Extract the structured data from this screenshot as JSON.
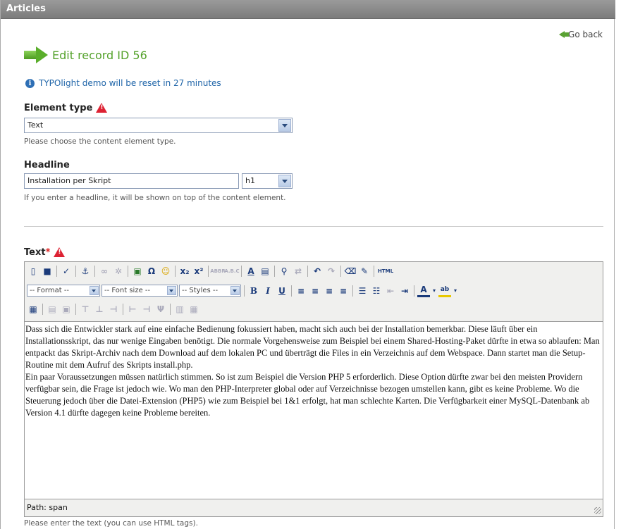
{
  "window": {
    "title": "Articles"
  },
  "nav": {
    "go_back": "Go back"
  },
  "page": {
    "title": "Edit record ID 56"
  },
  "info": {
    "message": "TYPOlight demo will be reset in 27 minutes"
  },
  "element_type": {
    "label": "Element type",
    "value": "Text",
    "help": "Please choose the content element type."
  },
  "headline": {
    "label": "Headline",
    "value": "Installation per Skript",
    "level": "h1",
    "help": "If you enter a headline, it will be shown on top of the content element."
  },
  "text": {
    "label": "Text",
    "required_mark": "*",
    "help": "Please enter the text (you can use HTML tags).",
    "paragraph_1": "Dass sich die Entwickler stark auf eine einfache Bedienung fokussiert haben, macht sich auch bei der Installation bemerkbar. Diese läuft über ein Installationsskript, das nur wenige Eingaben benötigt. Die normale Vorgehensweise zum Beispiel bei einem Shared-Hosting-Paket dürfte in etwa so ablaufen: Man entpackt das Skript-Archiv nach dem Download auf dem lokalen PC und überträgt die Files in ein Verzeichnis auf dem Webspace. Dann startet man die Setup-Routine mit dem Aufruf des Skripts install.php.",
    "paragraph_2": "Ein paar Voraussetzungen müssen natürlich stimmen. So ist zum Beispiel die Version PHP 5 erforderlich. Diese Option dürfte zwar bei den meisten Providern verfügbar sein, die Frage ist jedoch wie. Wo man den PHP-Interpreter global oder auf Verzeichnisse bezogen umstellen kann, gibt es keine Probleme. Wo die Steuerung jedoch über die Datei-Extension (PHP5) wie zum Beispiel bei 1&1 erfolgt, hat man schlechte Karten. Die Verfügbarkeit einer MySQL-Datenbank ab Version 4.1 dürfte dagegen keine Probleme bereiten.",
    "status_path": "Path: span"
  },
  "toolbar": {
    "format": "-- Format --",
    "font_size": "-- Font size --",
    "styles": "-- Styles --",
    "bold": "B",
    "italic": "I",
    "underline": "U",
    "html": "HTML",
    "omega": "Ω",
    "sub": "x₂",
    "sup": "x²"
  },
  "colors": {
    "accent_green": "#55a22c",
    "info_blue": "#1e64a8",
    "warning_red": "#d22"
  }
}
